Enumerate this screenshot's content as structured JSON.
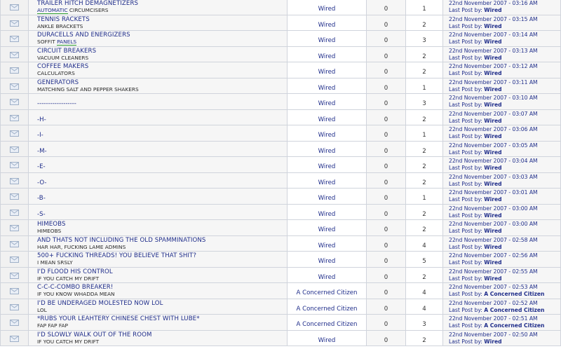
{
  "last_post_prefix": "Last Post by:",
  "threads": [
    {
      "title": "TRAILER HITCH DEMAGNETIZERS",
      "sub": "CIRCUMCISERS",
      "sub_highlight": "AUTOMATIC",
      "sub_hl_first": true,
      "author": "Wired",
      "replies": "0",
      "views": "1",
      "date": "22nd November 2007 - 03:16 AM",
      "last_by": "Wired"
    },
    {
      "title": "TENNIS RACKETS",
      "sub": "ANKLE BRACKETS",
      "author": "Wired",
      "replies": "0",
      "views": "2",
      "date": "22nd November 2007 - 03:15 AM",
      "last_by": "Wired"
    },
    {
      "title": "DURACELLS AND ENERGIZERS",
      "sub": "SOFFIT",
      "sub_highlight": "PANELS",
      "sub_hl_first": false,
      "author": "Wired",
      "replies": "0",
      "views": "3",
      "date": "22nd November 2007 - 03:14 AM",
      "last_by": "Wired"
    },
    {
      "title": "CIRCUIT BREAKERS",
      "sub": "VACUUM CLEANERS",
      "author": "Wired",
      "replies": "0",
      "views": "2",
      "date": "22nd November 2007 - 03:13 AM",
      "last_by": "Wired"
    },
    {
      "title": "COFFEE MAKERS",
      "sub": "CALCULATORS",
      "author": "Wired",
      "replies": "0",
      "views": "2",
      "date": "22nd November 2007 - 03:12 AM",
      "last_by": "Wired"
    },
    {
      "title": "GENERATORS",
      "sub": "MATCHING SALT AND PEPPER SHAKERS",
      "author": "Wired",
      "replies": "0",
      "views": "1",
      "date": "22nd November 2007 - 03:11 AM",
      "last_by": "Wired"
    },
    {
      "title": "------------------",
      "sub": "",
      "author": "Wired",
      "replies": "0",
      "views": "3",
      "date": "22nd November 2007 - 03:10 AM",
      "last_by": "Wired"
    },
    {
      "title": "-H-",
      "sub": "",
      "author": "Wired",
      "replies": "0",
      "views": "2",
      "date": "22nd November 2007 - 03:07 AM",
      "last_by": "Wired"
    },
    {
      "title": "-I-",
      "sub": "",
      "author": "Wired",
      "replies": "0",
      "views": "1",
      "date": "22nd November 2007 - 03:06 AM",
      "last_by": "Wired"
    },
    {
      "title": "-M-",
      "sub": "",
      "author": "Wired",
      "replies": "0",
      "views": "2",
      "date": "22nd November 2007 - 03:05 AM",
      "last_by": "Wired"
    },
    {
      "title": "-E-",
      "sub": "",
      "author": "Wired",
      "replies": "0",
      "views": "2",
      "date": "22nd November 2007 - 03:04 AM",
      "last_by": "Wired"
    },
    {
      "title": "-O-",
      "sub": "",
      "author": "Wired",
      "replies": "0",
      "views": "2",
      "date": "22nd November 2007 - 03:03 AM",
      "last_by": "Wired"
    },
    {
      "title": "-B-",
      "sub": "",
      "author": "Wired",
      "replies": "0",
      "views": "1",
      "date": "22nd November 2007 - 03:01 AM",
      "last_by": "Wired"
    },
    {
      "title": "-S-",
      "sub": "",
      "author": "Wired",
      "replies": "0",
      "views": "2",
      "date": "22nd November 2007 - 03:00 AM",
      "last_by": "Wired"
    },
    {
      "title": "HIMEOBS",
      "sub": "HIMEOBS",
      "author": "Wired",
      "replies": "0",
      "views": "2",
      "date": "22nd November 2007 - 03:00 AM",
      "last_by": "Wired"
    },
    {
      "title": "AND THATS NOT INCLUDING THE OLD SPAMMINATIONS",
      "sub": "HAR HAR, FUCKING LAME ADMINS",
      "author": "Wired",
      "replies": "0",
      "views": "4",
      "date": "22nd November 2007 - 02:58 AM",
      "last_by": "Wired"
    },
    {
      "title": "500+ FUCKING THREADS! YOU BELIEVE THAT SHIT?",
      "sub": "I MEAN SRSLY",
      "author": "Wired",
      "replies": "0",
      "views": "5",
      "date": "22nd November 2007 - 02:56 AM",
      "last_by": "Wired"
    },
    {
      "title": "I'D FLOOD HIS CONTROL",
      "sub": "IF YOU CATCH MY DRIFT",
      "author": "Wired",
      "replies": "0",
      "views": "2",
      "date": "22nd November 2007 - 02:55 AM",
      "last_by": "Wired"
    },
    {
      "title": "C-C-C-COMBO BREAKER!",
      "sub": "IF YOU KNOW WHADDA MEAN",
      "author": "A Concerned Citizen",
      "replies": "0",
      "views": "4",
      "date": "22nd November 2007 - 02:53 AM",
      "last_by": "A Concerned Citizen"
    },
    {
      "title": "I'D BE UNDERAGED MOLESTED NOW LOL",
      "sub": "LOL",
      "author": "A Concerned Citizen",
      "replies": "0",
      "views": "4",
      "date": "22nd November 2007 - 02:52 AM",
      "last_by": "A Concerned Citizen"
    },
    {
      "title": "*RUBS YOUR LEAHTERY CHINESE CHEST WITH LUBE*",
      "sub": "FAP FAP FAP",
      "author": "A Concerned Citizen",
      "replies": "0",
      "views": "3",
      "date": "22nd November 2007 - 02:51 AM",
      "last_by": "A Concerned Citizen"
    },
    {
      "title": "I'D SLOWLY WALK OUT OF THE ROOM",
      "sub": "IF YOU CATCH MY DRIFT",
      "author": "Wired",
      "replies": "0",
      "views": "2",
      "date": "22nd November 2007 - 02:50 AM",
      "last_by": "Wired"
    }
  ]
}
